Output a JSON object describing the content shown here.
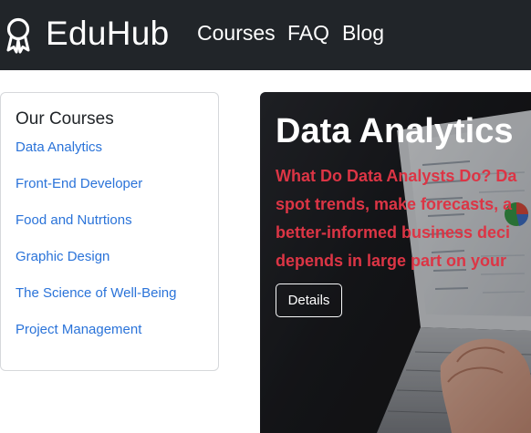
{
  "navbar": {
    "brand": "EduHub",
    "brand_icon": "award-icon",
    "links": [
      "Courses",
      "FAQ",
      "Blog"
    ]
  },
  "sidebar": {
    "title": "Our Courses",
    "courses": [
      "Data Analytics",
      "Front-End Developer",
      "Food and Nutrtions",
      "Graphic Design",
      "The Science of Well-Being",
      "Project Management"
    ]
  },
  "hero": {
    "title": "Data Analytics",
    "lines": [
      "What Do Data Analysts Do? Da",
      "spot trends, make forecasts, a",
      "better-informed business deci",
      "depends in large part on your"
    ],
    "button_label": "Details"
  },
  "colors": {
    "navbar_bg": "#212529",
    "link": "#2a73d9",
    "hero_text": "#dc3545"
  }
}
